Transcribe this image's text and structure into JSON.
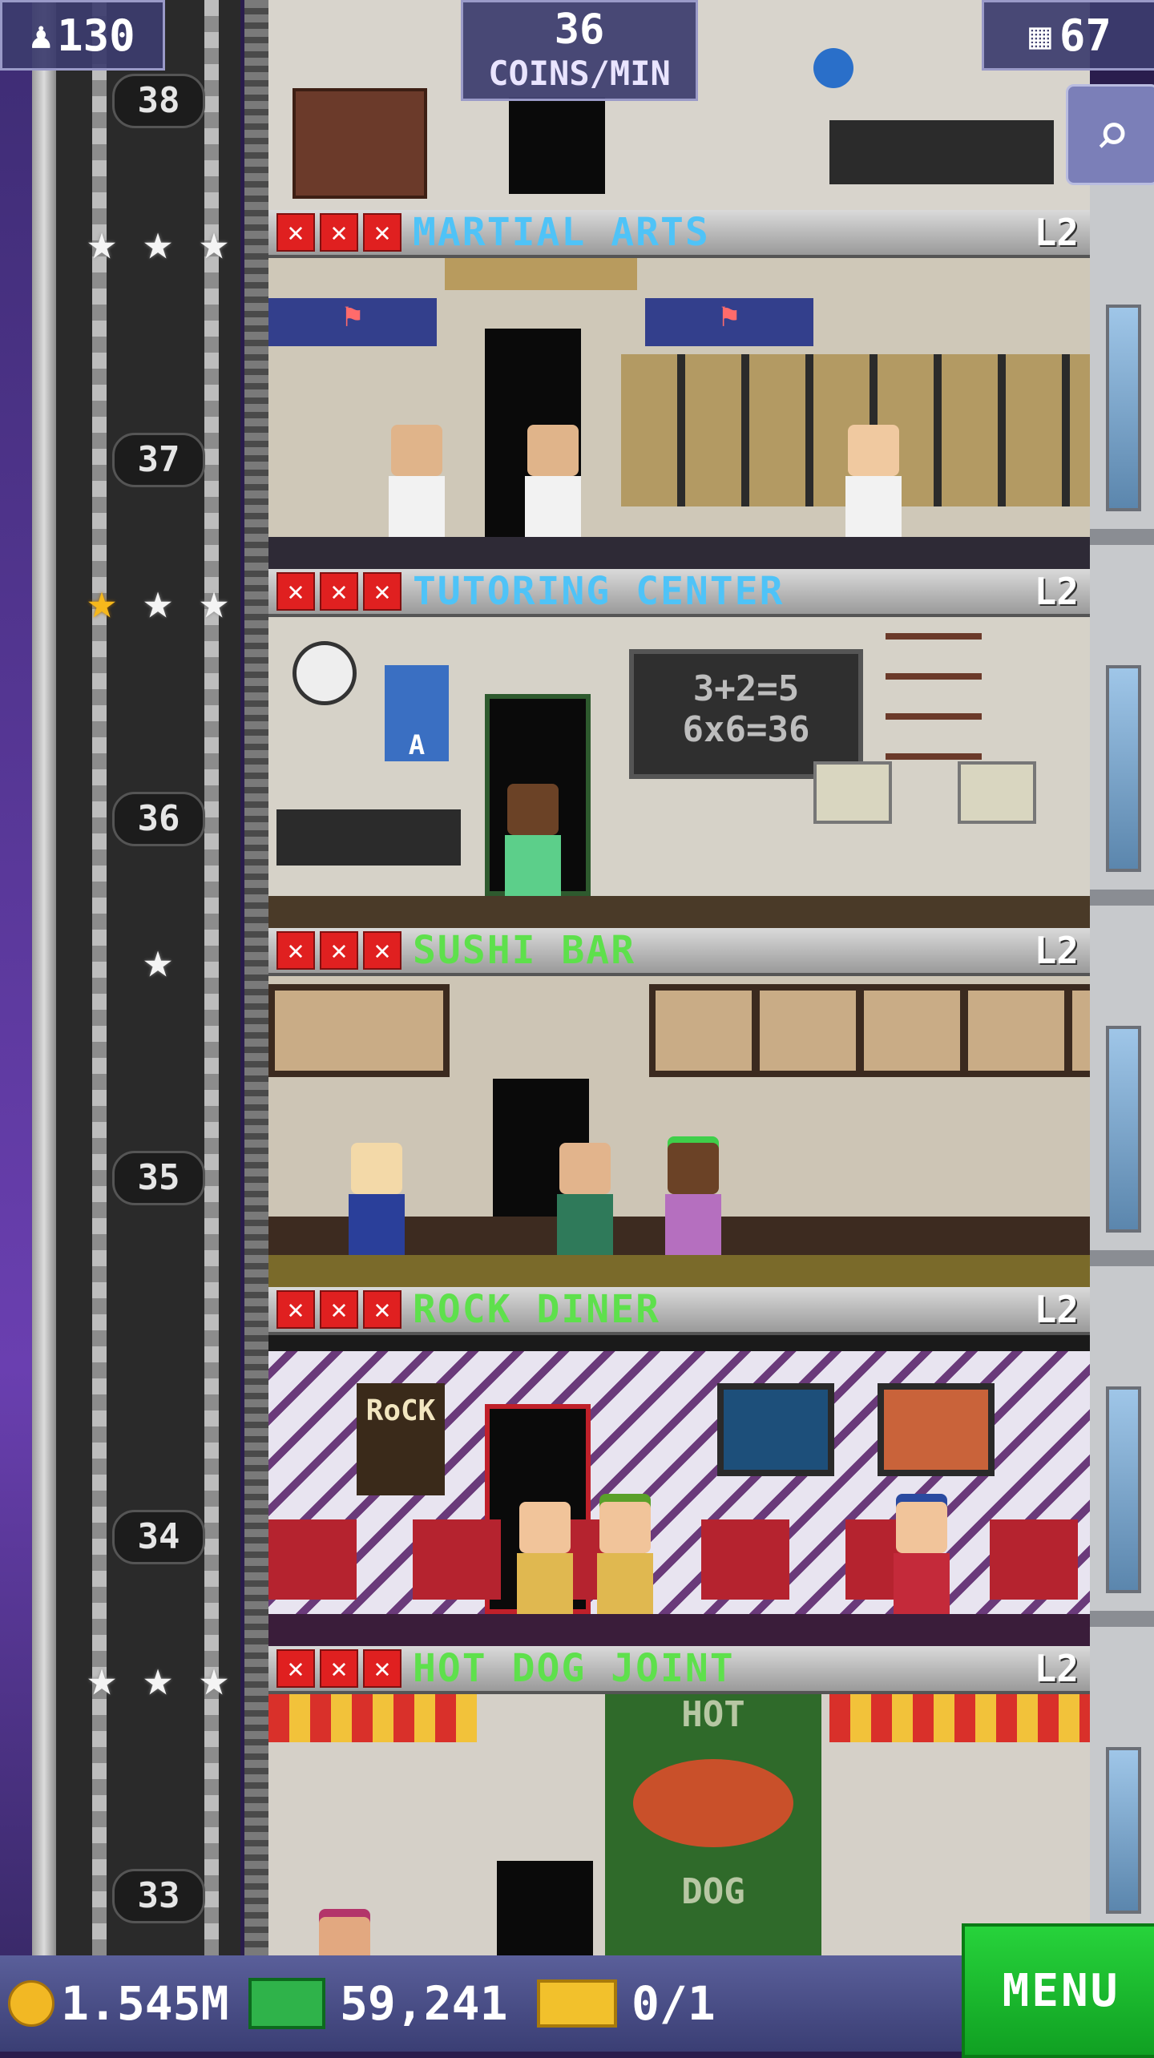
{
  "hud": {
    "population": "130",
    "coins_per_min_value": "36",
    "coins_per_min_unit": "COINS/MIN",
    "floors_count": "67"
  },
  "floor_numbers": [
    "38",
    "37",
    "36",
    "35",
    "34",
    "33"
  ],
  "floors": [
    {
      "name": "MARTIAL ARTS",
      "level": "L2",
      "name_color": "#4fc3f7",
      "stars_gold": 0,
      "stars_total": 3
    },
    {
      "name": "TUTORING CENTER",
      "level": "L2",
      "name_color": "#4fc3f7",
      "stars_gold": 1,
      "stars_total": 3
    },
    {
      "name": "SUSHI BAR",
      "level": "L2",
      "name_color": "#5ee04c",
      "stars_gold": 0,
      "stars_total": 1
    },
    {
      "name": "ROCK DINER",
      "level": "L2",
      "name_color": "#5ee04c",
      "stars_gold": 0,
      "stars_total": 0
    },
    {
      "name": "HOT DOG JOINT",
      "level": "L2",
      "name_color": "#5ee04c",
      "stars_gold": 0,
      "stars_total": 3
    }
  ],
  "scenery": {
    "chalkboard_line1": "3+2=5",
    "chalkboard_line2": "6x6=36",
    "poster_letter": "A",
    "hotdog_sign_top": "HOT",
    "hotdog_sign_bottom": "DOG",
    "rock_poster": "RoCK"
  },
  "bottom_bar": {
    "coins": "1.545M",
    "bux": "59,241",
    "tickets": "0/1",
    "menu_label": "MENU"
  },
  "icons": {
    "population": "person-icon",
    "floors": "building-icon",
    "zoom": "magnifier-icon",
    "coins": "coin-icon",
    "bux": "bux-icon",
    "tickets": "ticket-icon"
  }
}
